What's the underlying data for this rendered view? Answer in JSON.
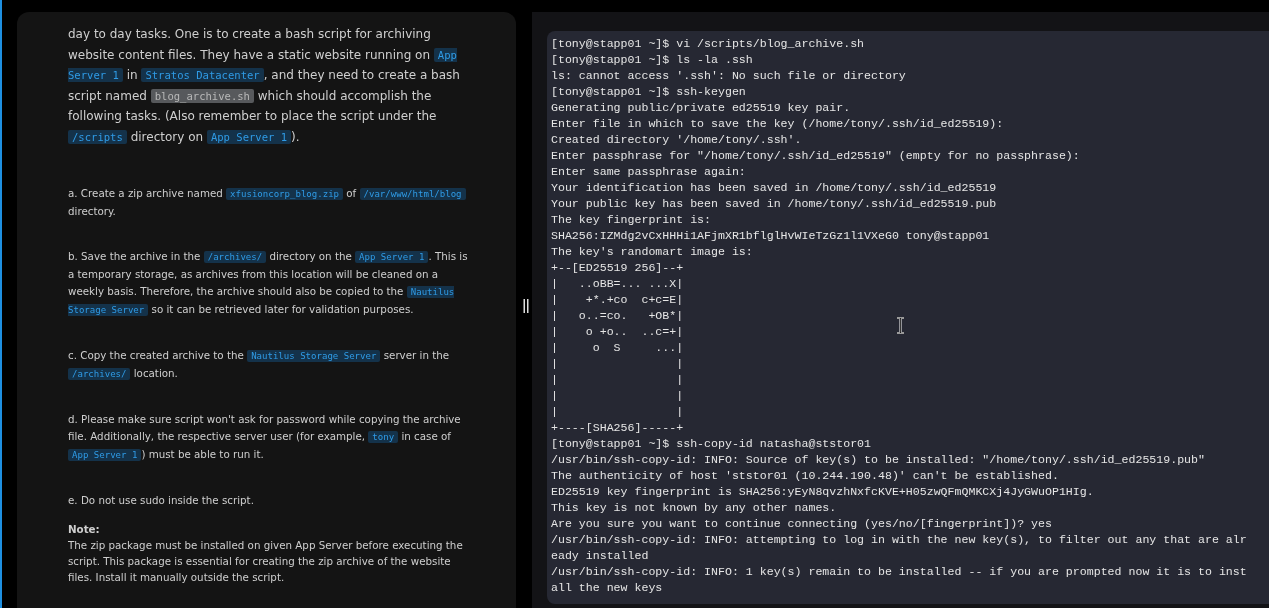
{
  "task": {
    "paragraphs": [
      {
        "kind": "intro",
        "segments": [
          {
            "kind": "text",
            "text": "day to day tasks. One is to create a bash script for archiving website content files. They have a static website running on "
          },
          {
            "kind": "code",
            "text": "App Server 1",
            "selected": false
          },
          {
            "kind": "text",
            "text": " in "
          },
          {
            "kind": "code",
            "text": "Stratos Datacenter",
            "selected": false
          },
          {
            "kind": "text",
            "text": ", and they need to create a bash script named "
          },
          {
            "kind": "code",
            "text": "blog_archive.sh",
            "selected": true
          },
          {
            "kind": "text",
            "text": " which should accomplish the following tasks. (Also remember to place the script under the "
          },
          {
            "kind": "code",
            "text": "/scripts",
            "selected": false
          },
          {
            "kind": "text",
            "text": " directory on "
          },
          {
            "kind": "code",
            "text": "App Server 1",
            "selected": false
          },
          {
            "kind": "text",
            "text": ")."
          }
        ]
      },
      {
        "kind": "item",
        "segments": [
          {
            "kind": "text",
            "text": "a. Create a zip archive named "
          },
          {
            "kind": "code",
            "text": "xfusioncorp_blog.zip",
            "selected": false
          },
          {
            "kind": "text",
            "text": " of "
          },
          {
            "kind": "code",
            "text": "/var/www/html/blog",
            "selected": false
          },
          {
            "kind": "text",
            "text": " directory."
          }
        ]
      },
      {
        "kind": "item",
        "segments": [
          {
            "kind": "text",
            "text": "b. Save the archive in the "
          },
          {
            "kind": "code",
            "text": "/archives/",
            "selected": false
          },
          {
            "kind": "text",
            "text": " directory on the "
          },
          {
            "kind": "code",
            "text": "App Server 1",
            "selected": false
          },
          {
            "kind": "text",
            "text": ". This is a temporary storage, as archives from this location will be cleaned on a weekly basis. Therefore, the archive should also be copied to the "
          },
          {
            "kind": "code",
            "text": "Nautilus Storage Server",
            "selected": false
          },
          {
            "kind": "text",
            "text": " so it can be retrieved later for validation purposes."
          }
        ]
      },
      {
        "kind": "item",
        "segments": [
          {
            "kind": "text",
            "text": "c. Copy the created archive to the "
          },
          {
            "kind": "code",
            "text": "Nautilus Storage Server",
            "selected": false
          },
          {
            "kind": "text",
            "text": " server in the "
          },
          {
            "kind": "code",
            "text": "/archives/",
            "selected": false
          },
          {
            "kind": "text",
            "text": " location."
          }
        ]
      },
      {
        "kind": "item",
        "segments": [
          {
            "kind": "text",
            "text": "d. Please make sure script won't ask for password while copying the archive file. Additionally, the respective server user (for example, "
          },
          {
            "kind": "code",
            "text": "tony",
            "selected": false
          },
          {
            "kind": "text",
            "text": " in case of "
          },
          {
            "kind": "code",
            "text": "App Server 1",
            "selected": false
          },
          {
            "kind": "text",
            "text": ") must be able to run it."
          }
        ]
      },
      {
        "kind": "item",
        "segments": [
          {
            "kind": "text",
            "text": "e. Do not use sudo inside the script."
          }
        ]
      }
    ],
    "note": {
      "heading": "Note:",
      "text": "The zip package must be installed on given App Server before executing the script. This package is essential for creating the zip archive of the website files. Install it manually outside the script."
    }
  },
  "terminal": {
    "lines": [
      "[tony@stapp01 ~]$ vi /scripts/blog_archive.sh",
      "[tony@stapp01 ~]$ ls -la .ssh",
      "ls: cannot access '.ssh': No such file or directory",
      "[tony@stapp01 ~]$ ssh-keygen",
      "Generating public/private ed25519 key pair.",
      "Enter file in which to save the key (/home/tony/.ssh/id_ed25519):",
      "Created directory '/home/tony/.ssh'.",
      "Enter passphrase for \"/home/tony/.ssh/id_ed25519\" (empty for no passphrase):",
      "Enter same passphrase again:",
      "Your identification has been saved in /home/tony/.ssh/id_ed25519",
      "Your public key has been saved in /home/tony/.ssh/id_ed25519.pub",
      "The key fingerprint is:",
      "SHA256:IZMdg2vCxHHHi1AFjmXR1bflglHvWIeTzGz1l1VXeG0 tony@stapp01",
      "The key's randomart image is:",
      "+--[ED25519 256]--+",
      "|   ..oBB=... ...X|",
      "|    +*.+co  c+c=E|",
      "|   o..=co.   +OB*|",
      "|    o +o..  ..c=+|",
      "|     o  S     ...|",
      "|                 |",
      "|                 |",
      "|                 |",
      "|                 |",
      "+----[SHA256]-----+",
      "[tony@stapp01 ~]$ ssh-copy-id natasha@ststor01",
      "/usr/bin/ssh-copy-id: INFO: Source of key(s) to be installed: \"/home/tony/.ssh/id_ed25519.pub\"",
      "The authenticity of host 'ststor01 (10.244.190.48)' can't be established.",
      "ED25519 key fingerprint is SHA256:yEyN8qvzhNxfcKVE+H05zwQFmQMKCXj4JyGWuOP1HIg.",
      "This key is not known by any other names.",
      "Are you sure you want to continue connecting (yes/no/[fingerprint])? yes",
      "/usr/bin/ssh-copy-id: INFO: attempting to log in with the new key(s), to filter out any that are alr",
      "eady installed",
      "/usr/bin/ssh-copy-id: INFO: 1 key(s) remain to be installed -- if you are prompted now it is to inst",
      "all the new keys"
    ]
  }
}
